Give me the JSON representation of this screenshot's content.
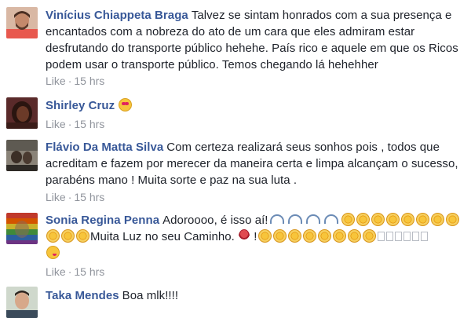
{
  "comments": [
    {
      "author": "Vinícius Chiappeta Braga",
      "text": "Talvez se sintam honrados com a sua presença e encantados com a nobreza do ato de um cara que eles admiram estar desfrutando do transporte público hehehe. País rico e aquele em que os Ricos podem usar o transporte público. Temos chegando lá hehehher",
      "like_label": "Like",
      "time": "15 hrs"
    },
    {
      "author": "Shirley Cruz",
      "like_label": "Like",
      "time": "15 hrs",
      "emoji": [
        "smiling-face-heart-eyes-emoji"
      ]
    },
    {
      "author": "Flávio Da Matta Silva",
      "text": "Com certeza realizará seus sonhos pois , todos que acreditam e fazem por merecer da maneira certa e limpa alcançam o sucesso, parabéns mano ! Muita sorte e paz na sua luta .",
      "like_label": "Like",
      "time": "15 hrs"
    },
    {
      "author": "Sonia Regina Penna",
      "text_a": "Adoroooo, é isso aí!",
      "text_b": "Muita Luz no seu Caminho.",
      "text_c": "!",
      "like_label": "Like",
      "time": "15 hrs",
      "emoji": [
        "wave-emoji",
        "sun-emoji",
        "rose-emoji",
        "winking-kiss-emoji",
        "missing-glyph-box"
      ]
    },
    {
      "author": "Taka Mendes",
      "text": "Boa mlk!!!!"
    }
  ],
  "colors": {
    "author_link": "#385898",
    "body_text": "#1d2129",
    "meta_text": "#90949c"
  }
}
